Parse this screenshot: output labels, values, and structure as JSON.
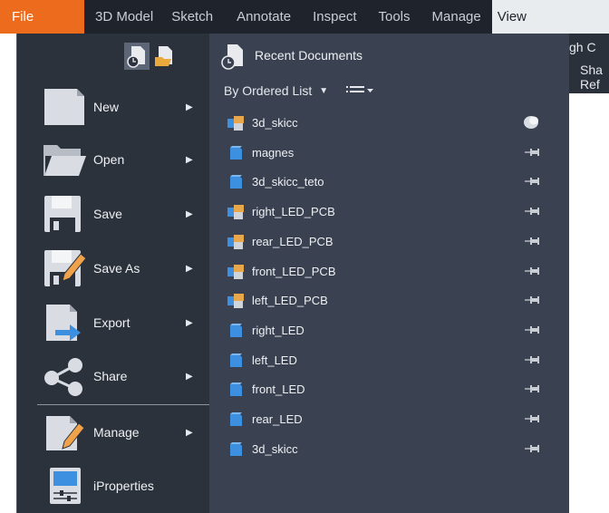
{
  "ribbon": {
    "tabs": [
      {
        "label": "File"
      },
      {
        "label": "3D Model"
      },
      {
        "label": "Sketch"
      },
      {
        "label": "Annotate"
      },
      {
        "label": "Inspect"
      },
      {
        "label": "Tools"
      },
      {
        "label": "Manage"
      },
      {
        "label": "View"
      }
    ]
  },
  "behind": {
    "line1": "gh C",
    "line2": "Sha",
    "line3": "Ref"
  },
  "file_menu": {
    "left_items": [
      {
        "label": "New",
        "icon": "new-document-icon",
        "has_submenu": true
      },
      {
        "label": "Open",
        "icon": "folder-open-icon",
        "has_submenu": true
      },
      {
        "label": "Save",
        "icon": "save-icon",
        "has_submenu": true
      },
      {
        "label": "Save As",
        "icon": "save-as-icon",
        "has_submenu": true
      },
      {
        "label": "Export",
        "icon": "export-icon",
        "has_submenu": true
      },
      {
        "label": "Share",
        "icon": "share-icon",
        "has_submenu": true
      },
      {
        "label": "Manage",
        "icon": "manage-icon",
        "has_submenu": true
      },
      {
        "label": "iProperties",
        "icon": "iproperties-icon",
        "has_submenu": false
      }
    ],
    "recent": {
      "title": "Recent Documents",
      "order_label": "By Ordered List",
      "documents": [
        {
          "name": "3d_skicc",
          "type": "assembly",
          "pinned": true
        },
        {
          "name": "magnes",
          "type": "part",
          "pinned": false
        },
        {
          "name": "3d_skicc_teto",
          "type": "part",
          "pinned": false
        },
        {
          "name": "right_LED_PCB",
          "type": "assembly",
          "pinned": false
        },
        {
          "name": "rear_LED_PCB",
          "type": "assembly",
          "pinned": false
        },
        {
          "name": "front_LED_PCB",
          "type": "assembly",
          "pinned": false
        },
        {
          "name": "left_LED_PCB",
          "type": "assembly",
          "pinned": false
        },
        {
          "name": "right_LED",
          "type": "part",
          "pinned": false
        },
        {
          "name": "left_LED",
          "type": "part",
          "pinned": false
        },
        {
          "name": "front_LED",
          "type": "part",
          "pinned": false
        },
        {
          "name": "rear_LED",
          "type": "part",
          "pinned": false
        },
        {
          "name": "3d_skicc",
          "type": "part",
          "pinned": false
        }
      ]
    }
  },
  "colors": {
    "file_tab": "#ec6b1c",
    "ribbon_bg": "#1f232b",
    "menu_left": "#2c323c",
    "menu_right": "#3a4150",
    "part_blue": "#3d8fe0"
  }
}
